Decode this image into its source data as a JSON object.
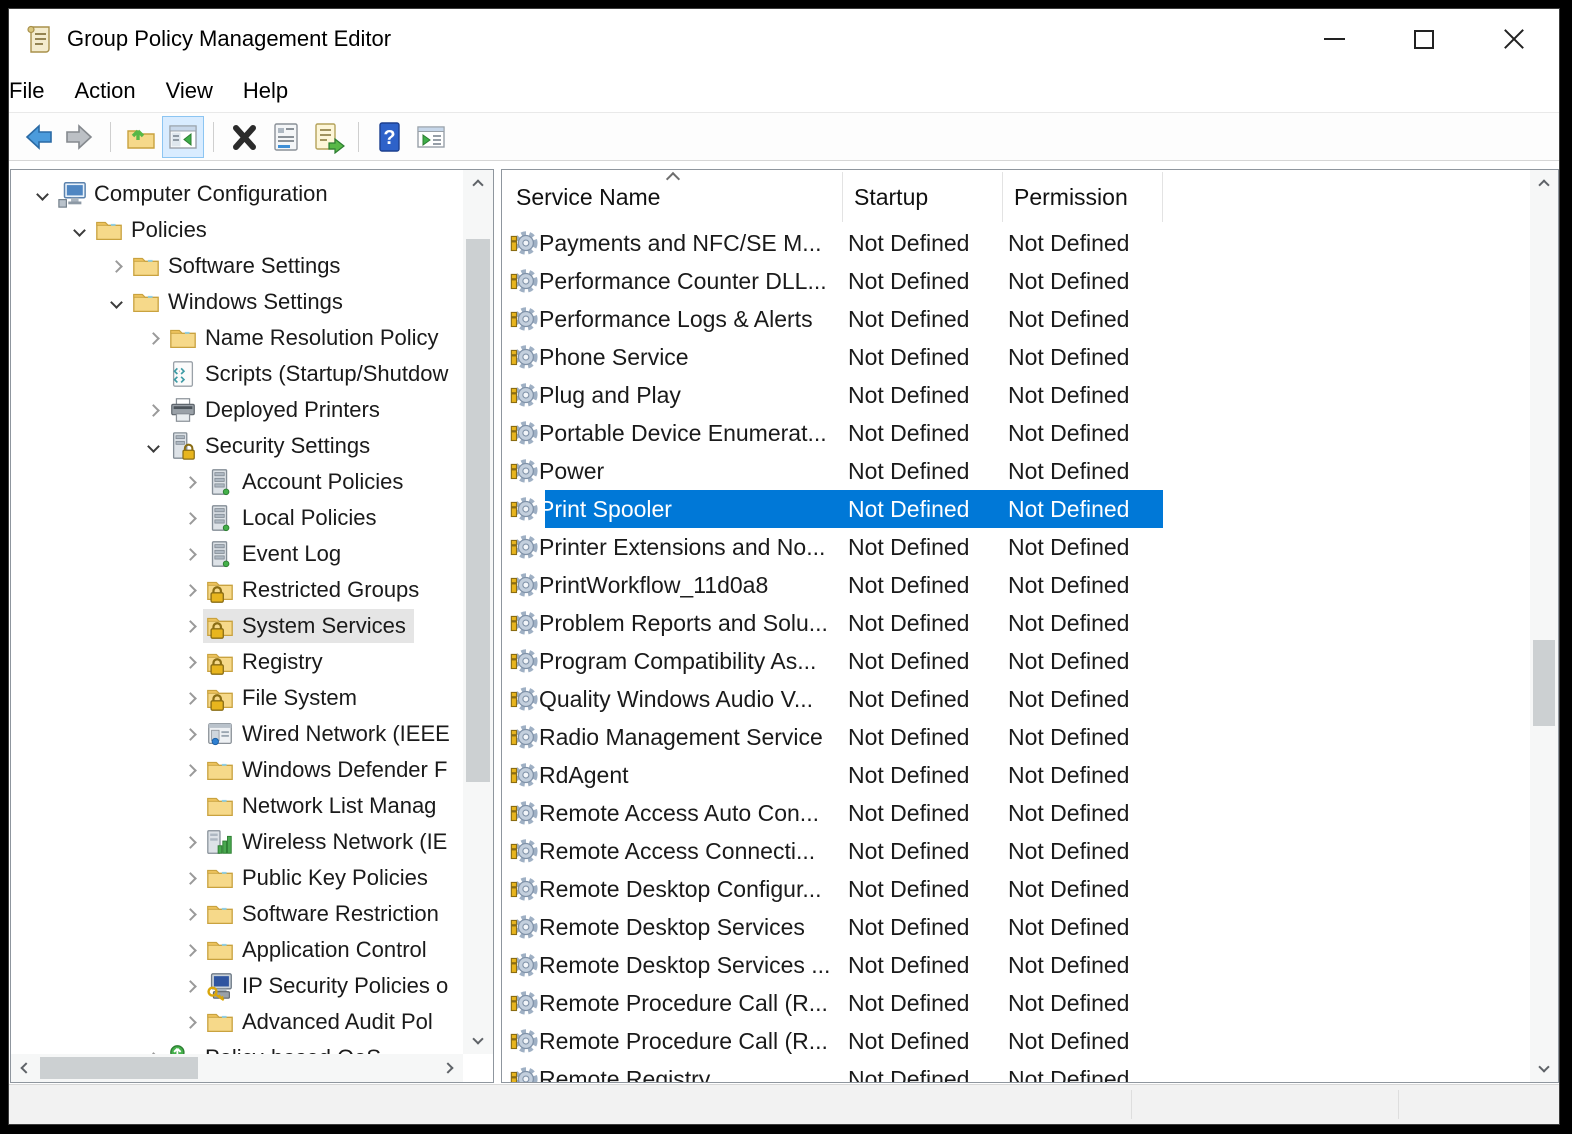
{
  "window": {
    "title": "Group Policy Management Editor",
    "controls": [
      "minimize",
      "maximize",
      "close"
    ]
  },
  "menu": {
    "items": [
      "File",
      "Action",
      "View",
      "Help"
    ]
  },
  "toolbar": {
    "buttons": [
      "back",
      "forward",
      "up-one-level",
      "show-console-tree",
      "delete",
      "properties",
      "export-list",
      "help",
      "new-window"
    ],
    "active_button": "show-console-tree"
  },
  "tree": {
    "items": [
      {
        "label": "Computer Configuration",
        "level": 0,
        "expander": "expanded",
        "icon": "computer"
      },
      {
        "label": "Policies",
        "level": 1,
        "expander": "expanded",
        "icon": "folder"
      },
      {
        "label": "Software Settings",
        "level": 2,
        "expander": "collapsed",
        "icon": "folder"
      },
      {
        "label": "Windows Settings",
        "level": 2,
        "expander": "expanded",
        "icon": "folder"
      },
      {
        "label": "Name Resolution Policy",
        "level": 3,
        "expander": "collapsed",
        "icon": "folder"
      },
      {
        "label": "Scripts (Startup/Shutdow",
        "level": 3,
        "expander": "none",
        "icon": "script"
      },
      {
        "label": "Deployed Printers",
        "level": 3,
        "expander": "collapsed",
        "icon": "printer"
      },
      {
        "label": "Security Settings",
        "level": 3,
        "expander": "expanded",
        "icon": "server-lock"
      },
      {
        "label": "Account Policies",
        "level": 4,
        "expander": "collapsed",
        "icon": "server"
      },
      {
        "label": "Local Policies",
        "level": 4,
        "expander": "collapsed",
        "icon": "server"
      },
      {
        "label": "Event Log",
        "level": 4,
        "expander": "collapsed",
        "icon": "server"
      },
      {
        "label": "Restricted Groups",
        "level": 4,
        "expander": "collapsed",
        "icon": "folder-lock"
      },
      {
        "label": "System Services",
        "level": 4,
        "expander": "collapsed",
        "icon": "folder-lock",
        "selected": true
      },
      {
        "label": "Registry",
        "level": 4,
        "expander": "collapsed",
        "icon": "folder-lock"
      },
      {
        "label": "File System",
        "level": 4,
        "expander": "collapsed",
        "icon": "folder-lock"
      },
      {
        "label": "Wired Network (IEEE",
        "level": 4,
        "expander": "collapsed",
        "icon": "network"
      },
      {
        "label": "Windows Defender F",
        "level": 4,
        "expander": "collapsed",
        "icon": "folder"
      },
      {
        "label": "Network List Manag",
        "level": 4,
        "expander": "none",
        "icon": "folder"
      },
      {
        "label": "Wireless Network (IE",
        "level": 4,
        "expander": "collapsed",
        "icon": "wireless"
      },
      {
        "label": "Public Key Policies",
        "level": 4,
        "expander": "collapsed",
        "icon": "folder"
      },
      {
        "label": "Software Restriction",
        "level": 4,
        "expander": "collapsed",
        "icon": "folder"
      },
      {
        "label": "Application Control",
        "level": 4,
        "expander": "collapsed",
        "icon": "folder"
      },
      {
        "label": "IP Security Policies o",
        "level": 4,
        "expander": "collapsed",
        "icon": "computer-key"
      },
      {
        "label": "Advanced Audit Pol",
        "level": 4,
        "expander": "collapsed",
        "icon": "folder"
      },
      {
        "label": "Policy-based QoS",
        "level": 3,
        "expander": "collapsed",
        "icon": "qos",
        "clipped": true
      }
    ]
  },
  "list": {
    "columns": [
      "Service Name",
      "Startup",
      "Permission"
    ],
    "sort": {
      "column": "Service Name",
      "direction": "ascending"
    },
    "rows": [
      {
        "name": "Payments and NFC/SE M...",
        "startup": "Not Defined",
        "permission": "Not Defined"
      },
      {
        "name": "Performance Counter DLL...",
        "startup": "Not Defined",
        "permission": "Not Defined"
      },
      {
        "name": "Performance Logs & Alerts",
        "startup": "Not Defined",
        "permission": "Not Defined"
      },
      {
        "name": "Phone Service",
        "startup": "Not Defined",
        "permission": "Not Defined"
      },
      {
        "name": "Plug and Play",
        "startup": "Not Defined",
        "permission": "Not Defined"
      },
      {
        "name": "Portable Device Enumerat...",
        "startup": "Not Defined",
        "permission": "Not Defined"
      },
      {
        "name": "Power",
        "startup": "Not Defined",
        "permission": "Not Defined"
      },
      {
        "name": "Print Spooler",
        "startup": "Not Defined",
        "permission": "Not Defined",
        "selected": true
      },
      {
        "name": "Printer Extensions and No...",
        "startup": "Not Defined",
        "permission": "Not Defined"
      },
      {
        "name": "PrintWorkflow_11d0a8",
        "startup": "Not Defined",
        "permission": "Not Defined"
      },
      {
        "name": "Problem Reports and Solu...",
        "startup": "Not Defined",
        "permission": "Not Defined"
      },
      {
        "name": "Program Compatibility As...",
        "startup": "Not Defined",
        "permission": "Not Defined"
      },
      {
        "name": "Quality Windows Audio V...",
        "startup": "Not Defined",
        "permission": "Not Defined"
      },
      {
        "name": "Radio Management Service",
        "startup": "Not Defined",
        "permission": "Not Defined"
      },
      {
        "name": "RdAgent",
        "startup": "Not Defined",
        "permission": "Not Defined"
      },
      {
        "name": "Remote Access Auto Con...",
        "startup": "Not Defined",
        "permission": "Not Defined"
      },
      {
        "name": "Remote Access Connecti...",
        "startup": "Not Defined",
        "permission": "Not Defined"
      },
      {
        "name": "Remote Desktop Configur...",
        "startup": "Not Defined",
        "permission": "Not Defined"
      },
      {
        "name": "Remote Desktop Services",
        "startup": "Not Defined",
        "permission": "Not Defined"
      },
      {
        "name": "Remote Desktop Services ...",
        "startup": "Not Defined",
        "permission": "Not Defined"
      },
      {
        "name": "Remote Procedure Call (R...",
        "startup": "Not Defined",
        "permission": "Not Defined"
      },
      {
        "name": "Remote Procedure Call (R...",
        "startup": "Not Defined",
        "permission": "Not Defined"
      },
      {
        "name": "Remote Registry",
        "startup": "Not Defined",
        "permission": "Not Defined"
      }
    ]
  },
  "colors": {
    "selection_active": "#0078d7",
    "selection_inactive": "#e5e5e5",
    "pane_border": "#8f969e",
    "toolbar_active_button_bg": "#d9ecff"
  }
}
